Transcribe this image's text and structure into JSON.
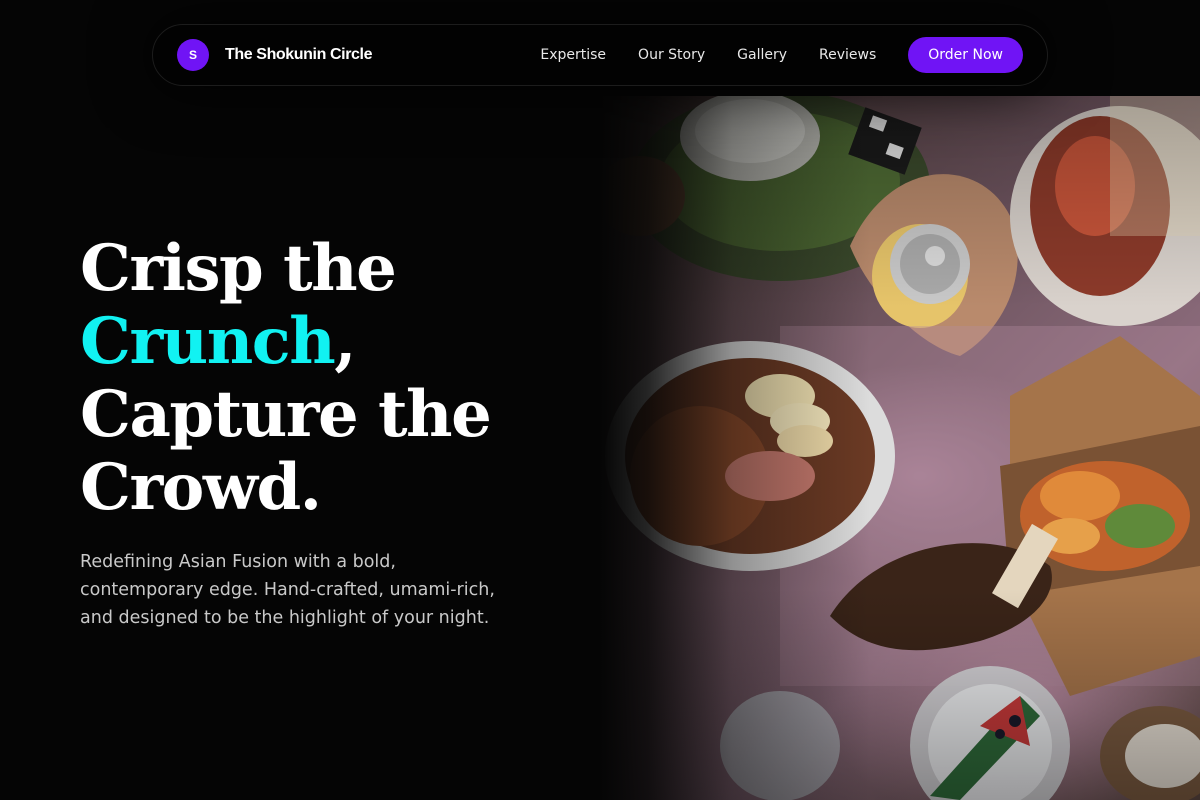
{
  "nav": {
    "brand_initial": "S",
    "brand_name": "The Shokunin Circle",
    "links": [
      "Expertise",
      "Our Story",
      "Gallery",
      "Reviews"
    ],
    "cta_label": "Order Now"
  },
  "hero": {
    "headline_line1": "Crisp the",
    "headline_accent": "Crunch",
    "headline_comma": ",",
    "headline_line3": "Capture the",
    "headline_line4": "Crowd.",
    "description": "Redefining Asian Fusion with a bold, contemporary edge. Hand-crafted, umami-rich, and designed to be the highlight of your night."
  },
  "colors": {
    "background": "#050505",
    "brand_purple": "#7014f5",
    "accent_cyan": "#11f2f2",
    "text_primary": "#ffffff",
    "text_muted": "#c9c9c9"
  },
  "images": {
    "hero_photo": "food-spread-photo"
  }
}
